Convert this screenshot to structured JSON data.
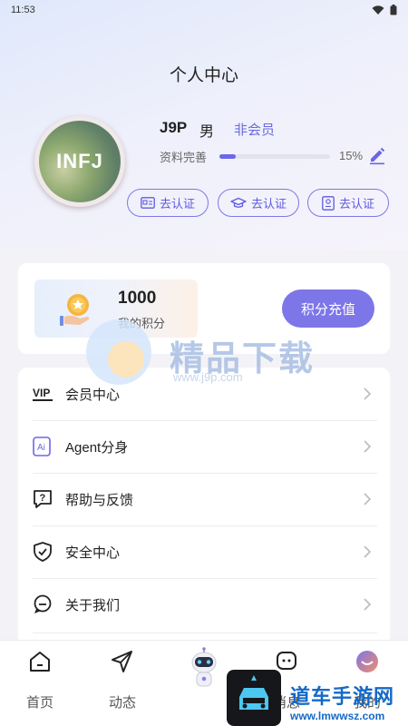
{
  "status_bar": {
    "time": "11:53"
  },
  "header": {
    "title": "个人中心"
  },
  "profile": {
    "avatar_text": "INFJ",
    "name": "J9P",
    "gender": "男",
    "member_status": "非会员",
    "completion_label": "资料完善",
    "completion_percent": 15,
    "completion_text": "15%",
    "verify_buttons": [
      {
        "label": "去认证",
        "icon": "id-card-icon"
      },
      {
        "label": "去认证",
        "icon": "graduation-cap-icon"
      },
      {
        "label": "去认证",
        "icon": "work-badge-icon"
      }
    ]
  },
  "points": {
    "value": "1000",
    "label": "我的积分",
    "recharge_label": "积分充值"
  },
  "menu": {
    "items": [
      {
        "label": "会员中心",
        "icon": "vip-icon"
      },
      {
        "label": "Agent分身",
        "icon": "ai-icon"
      },
      {
        "label": "帮助与反馈",
        "icon": "help-icon"
      },
      {
        "label": "安全中心",
        "icon": "shield-icon"
      },
      {
        "label": "关于我们",
        "icon": "chat-bubble-icon"
      }
    ]
  },
  "tabs": [
    {
      "label": "首页",
      "icon": "home-icon"
    },
    {
      "label": "动态",
      "icon": "send-icon"
    },
    {
      "label": "",
      "icon": "robot-icon"
    },
    {
      "label": "消息",
      "icon": "message-icon"
    },
    {
      "label": "我的",
      "icon": "profile-icon"
    }
  ],
  "watermarks": {
    "center_title": "精品下载",
    "center_url": "www.j9p.com",
    "bottom_title": "道车手游网",
    "bottom_url": "www.lmwwsz.com"
  },
  "colors": {
    "accent": "#6b6be0",
    "button": "#7d76e9",
    "text": "#222222"
  }
}
